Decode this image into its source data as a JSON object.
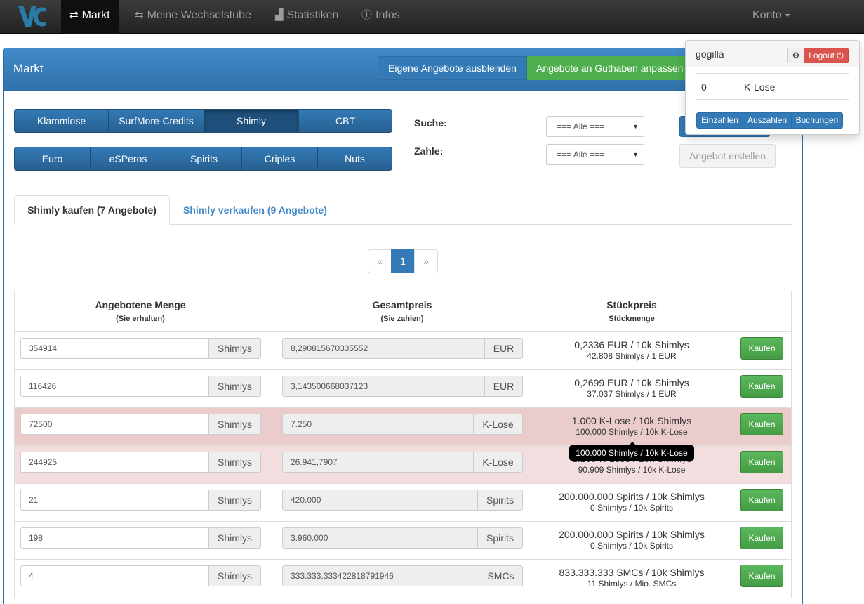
{
  "nav": {
    "items": [
      {
        "label": "Markt",
        "icon": "retweet-icon"
      },
      {
        "label": "Meine Wechselstube",
        "icon": "transfer-icon"
      },
      {
        "label": "Statistiken",
        "icon": "stats-icon"
      },
      {
        "label": "Infos",
        "icon": "info-icon"
      }
    ],
    "account": "Konto"
  },
  "panel": {
    "title": "Markt",
    "hide_own": "Eigene Angebote ausblenden",
    "adjust": "Angebote an Guthaben anpassen"
  },
  "currencies_row1": [
    "Klammlose",
    "SurfMore-Credits",
    "Shimly",
    "CBT"
  ],
  "currencies_row2": [
    "Euro",
    "eSPeros",
    "Spirits",
    "Criples",
    "Nuts"
  ],
  "filters": {
    "search_label": "Suche:",
    "pay_label": "Zahle:",
    "search_value": "=== Alle ===",
    "pay_value": "=== Alle ===",
    "create": "Angebot erstellen"
  },
  "tabs": {
    "buy": "Shimly kaufen (7 Angebote)",
    "sell": "Shimly verkaufen (9 Angebote)"
  },
  "pagination": {
    "prev": "«",
    "page": "1",
    "next": "»"
  },
  "table": {
    "col1": "Angebotene Menge",
    "col1_sub": "(Sie erhalten)",
    "col2": "Gesamtpreis",
    "col2_sub": "(Sie zahlen)",
    "col3": "Stückpreis",
    "col3_sub": "Stückmenge",
    "buy_label": "Kaufen",
    "rows": [
      {
        "amount": "354914",
        "unit": "Shimlys",
        "total": "8,290815670335552",
        "currency": "EUR",
        "price": "0,2336 EUR / 10k Shimlys",
        "per": "42.808 Shimlys / 1 EUR"
      },
      {
        "amount": "116426",
        "unit": "Shimlys",
        "total": "3,143500668037123",
        "currency": "EUR",
        "price": "0,2699 EUR / 10k Shimlys",
        "per": "37.037 Shimlys / 1 EUR"
      },
      {
        "amount": "72500",
        "unit": "Shimlys",
        "total": "7.250",
        "currency": "K-Lose",
        "price": "1.000 K-Lose / 10k Shimlys",
        "per": "100.000 Shimlys / 10k K-Lose"
      },
      {
        "amount": "244925",
        "unit": "Shimlys",
        "total": "26.941,7907",
        "currency": "K-Lose",
        "price": "1.100 K-Lose / 10k Shimlys",
        "per": "90.909 Shimlys / 10k K-Lose"
      },
      {
        "amount": "21",
        "unit": "Shimlys",
        "total": "420.000",
        "currency": "Spirits",
        "price": "200.000.000 Spirits / 10k Shimlys",
        "per": "0 Shimlys / 10k Spirits"
      },
      {
        "amount": "198",
        "unit": "Shimlys",
        "total": "3.960.000",
        "currency": "Spirits",
        "price": "200.000.000 Spirits / 10k Shimlys",
        "per": "0 Shimlys / 10k Spirits"
      },
      {
        "amount": "4",
        "unit": "Shimlys",
        "total": "333.333,333422818791946",
        "currency": "SMCs",
        "price": "833.333.333 SMCs / 10k Shimlys",
        "per": "11 Shimlys / Mio. SMCs"
      }
    ]
  },
  "tooltip": "100.000 Shimlys / 10k K-Lose",
  "account_menu": {
    "username": "gogilla",
    "logout": "Logout",
    "balance": "0",
    "balance_currency": "K-Lose",
    "deposit": "Einzahlen",
    "withdraw": "Auszahlen",
    "bookings": "Buchungen"
  }
}
